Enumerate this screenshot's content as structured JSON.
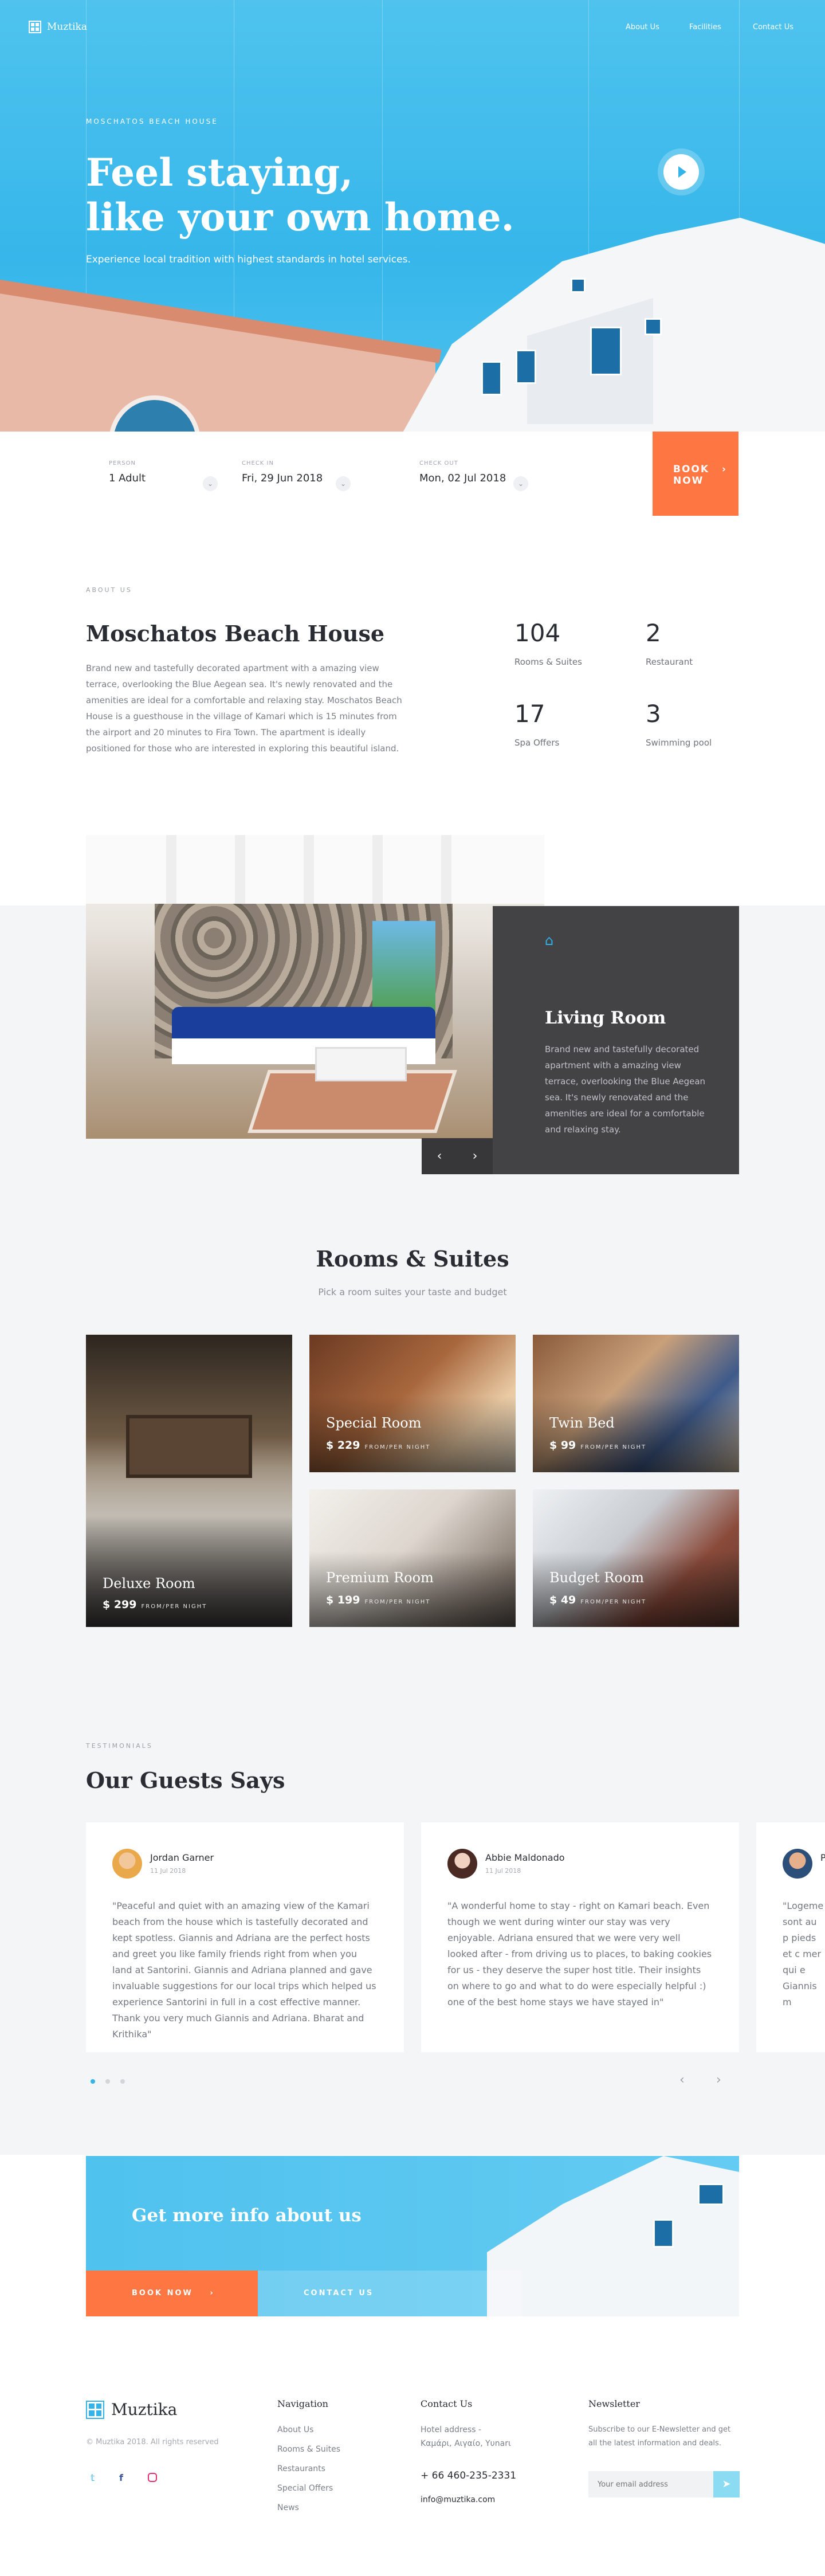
{
  "brand": {
    "name": "Muztika",
    "accent": "#35b4ea",
    "orange": "#fe7743",
    "dark": "#434346"
  },
  "nav": {
    "items": [
      "About Us",
      "Facilities",
      "Contact Us"
    ]
  },
  "hero": {
    "eyebrow": "Moschatos Beach House",
    "title_line1": "Feel staying,",
    "title_line2": "like your own home.",
    "subtitle": "Experience local tradition with highest standards in hotel services.",
    "play_icon": "play-icon"
  },
  "booking": {
    "fields": [
      {
        "label": "Person",
        "value": "1 Adult"
      },
      {
        "label": "Check in",
        "value": "Fri, 29 Jun 2018"
      },
      {
        "label": "Check out",
        "value": "Mon, 02 Jul 2018"
      }
    ],
    "button_line1": "BOOK",
    "button_line2": "NOW",
    "button_icon": "›"
  },
  "about": {
    "eyebrow": "About us",
    "title": "Moschatos Beach House",
    "text": "Brand new and tastefully decorated apartment with a amazing view terrace, overlooking the Blue Aegean sea. It's newly renovated and the amenities are ideal for a comfortable and relaxing stay. Moschatos Beach House is a guesthouse in the village of Kamari which is 15 minutes from the airport and 20 minutes to Fira Town. The apartment is ideally positioned for those who are interested in exploring this beautiful island.",
    "stats": [
      {
        "num": "104",
        "label": "Rooms & Suites"
      },
      {
        "num": "2",
        "label": "Restaurant"
      },
      {
        "num": "17",
        "label": "Spa Offers"
      },
      {
        "num": "3",
        "label": "Swimming pool"
      }
    ]
  },
  "living": {
    "title": "Living Room",
    "text": "Brand new and tastefully decorated apartment with a amazing view terrace, overlooking the Blue Aegean sea. It's newly renovated and the amenities are ideal for a comfortable and relaxing stay.",
    "prev": "‹",
    "next": "›"
  },
  "rooms": {
    "title": "Rooms & Suites",
    "subtitle": "Pick a room suites your taste and budget",
    "unit": "FROM/PER NIGHT",
    "items": [
      {
        "name": "Deluxe Room",
        "price": "$ 299"
      },
      {
        "name": "Special Room",
        "price": "$ 229"
      },
      {
        "name": "Twin Bed",
        "price": "$ 99"
      },
      {
        "name": "Premium Room",
        "price": "$ 199"
      },
      {
        "name": "Budget Room",
        "price": "$ 49"
      }
    ]
  },
  "testimonials": {
    "eyebrow": "Testimonials",
    "title": "Our Guests Says",
    "items": [
      {
        "name": "Jordan Garner",
        "date": "11 Jul 2018",
        "quote": "\"Peaceful and quiet with an amazing view of the Kamari beach from the house which is tastefully decorated and kept spotless. Giannis and Adriana are the perfect hosts and greet you like family friends right from when you land at Santorini. Giannis and Adriana planned and gave invaluable suggestions for our local trips which helped us experience Santorini in full in a cost effective manner. Thank you very much Giannis and Adriana. Bharat and Krithika\""
      },
      {
        "name": "Abbie Maldonado",
        "date": "11 Jul 2018",
        "quote": "\"A wonderful home to stay - right on Kamari beach. Even though we went during winter our stay was very enjoyable. Adriana ensured that we were very well looked after - from driving us to places, to baking cookies for us - they deserve the super host title. Their insights on where to go and what to do were especially helpful :) one of the best home stays we have stayed in\""
      },
      {
        "name": "P",
        "date": "",
        "quote": "\"Logeme sont au p pieds et c mer qui e Giannis m"
      }
    ],
    "prev": "‹",
    "next": "›"
  },
  "cta": {
    "title": "Get more info about us",
    "book": "BOOK NOW",
    "book_icon": "›",
    "contact": "CONTACT US"
  },
  "footer": {
    "brand": "Muztika",
    "copyright": "© Muztika 2018. All rights reserved",
    "social": [
      "twitter-icon",
      "facebook-icon",
      "instagram-icon"
    ],
    "nav_title": "Navigation",
    "nav_links": [
      "About Us",
      "Rooms & Suites",
      "Restaurants",
      "Special Offers",
      "News"
    ],
    "contact_title": "Contact Us",
    "address_line1": "Hotel address -",
    "address_line2": "Καμάρι, Αιγαίο, Υυnarι",
    "phone": "+ 66 460-235-2331",
    "email": "info@muztika.com",
    "newsletter_title": "Newsletter",
    "newsletter_text": "Subscribe to our E-Newsletter and get all the latest information and deals.",
    "email_placeholder": "Your email address"
  }
}
